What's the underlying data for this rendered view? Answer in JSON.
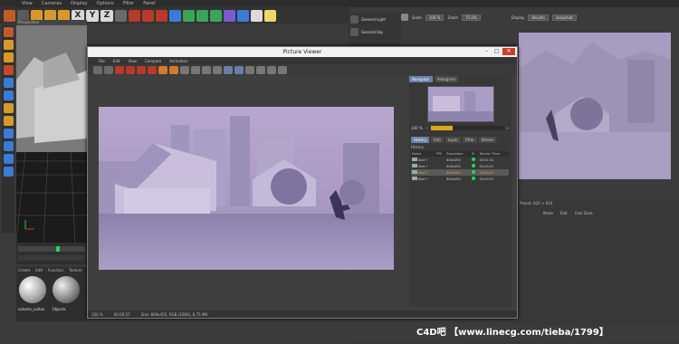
{
  "menubar": {
    "items": [
      "View",
      "Cameras",
      "Display",
      "Options",
      "Filter",
      "Panel"
    ]
  },
  "toolbar": {
    "axis_labels": [
      "X",
      "Y",
      "Z"
    ]
  },
  "viewport": {
    "label": "Perspective"
  },
  "materials": {
    "menu": [
      "Create",
      "Edit",
      "Function",
      "Texture"
    ],
    "items": [
      "volume_cuttex",
      "Objects"
    ]
  },
  "objects": {
    "items": [
      "General Light",
      "General Sky"
    ]
  },
  "render_settings": {
    "scale_label": "Scale",
    "scale_value": "100 %",
    "zoom_label": "Zoom",
    "zoom_value": "75.0%",
    "display_label": "Display",
    "display_value": "Results",
    "snapshot_label": "Snapshot"
  },
  "attributes": {
    "header": "Preset: 820 × 610",
    "menu": [
      "Mode",
      "Edit",
      "User Data"
    ]
  },
  "picture_viewer": {
    "title": "Picture Viewer",
    "menu": [
      "File",
      "Edit",
      "View",
      "Compare",
      "Animation"
    ],
    "status": {
      "zoom": "100 %",
      "time": "00:00:57",
      "size": "Size: 800x450, RGB (32Bit), 8.75 MB"
    },
    "nav_tabs": [
      "Navigator",
      "Histogram"
    ],
    "nav_zoom": "100 %",
    "nav_zoom_fraction": 0.3,
    "history_tabs": [
      "History",
      "Info",
      "Layer",
      "Filter",
      "Stereo"
    ],
    "history_label": "History",
    "history_columns": [
      "Name",
      "FPS",
      "Resolution",
      "R",
      "Render Time"
    ],
    "history_rows": [
      {
        "name": "Bart *",
        "fps": "",
        "res": "800x450",
        "time": "00:01:02",
        "selected": false
      },
      {
        "name": "Bart *",
        "fps": "",
        "res": "800x450",
        "time": "00:00:47",
        "selected": false
      },
      {
        "name": "Bart *",
        "fps": "",
        "res": "800x450",
        "time": "00:00:47",
        "selected": true
      },
      {
        "name": "Bart *",
        "fps": "",
        "res": "800x450",
        "time": "00:00:57",
        "selected": false
      }
    ]
  },
  "watermark": "C4D吧 【www.linecg.com/tieba/1799】",
  "colors": {
    "accent": "#6a7fa8",
    "selected_text": "#e1a63a",
    "ok_dot": "#1fd65a",
    "zoom_fill": "#d8a920"
  }
}
